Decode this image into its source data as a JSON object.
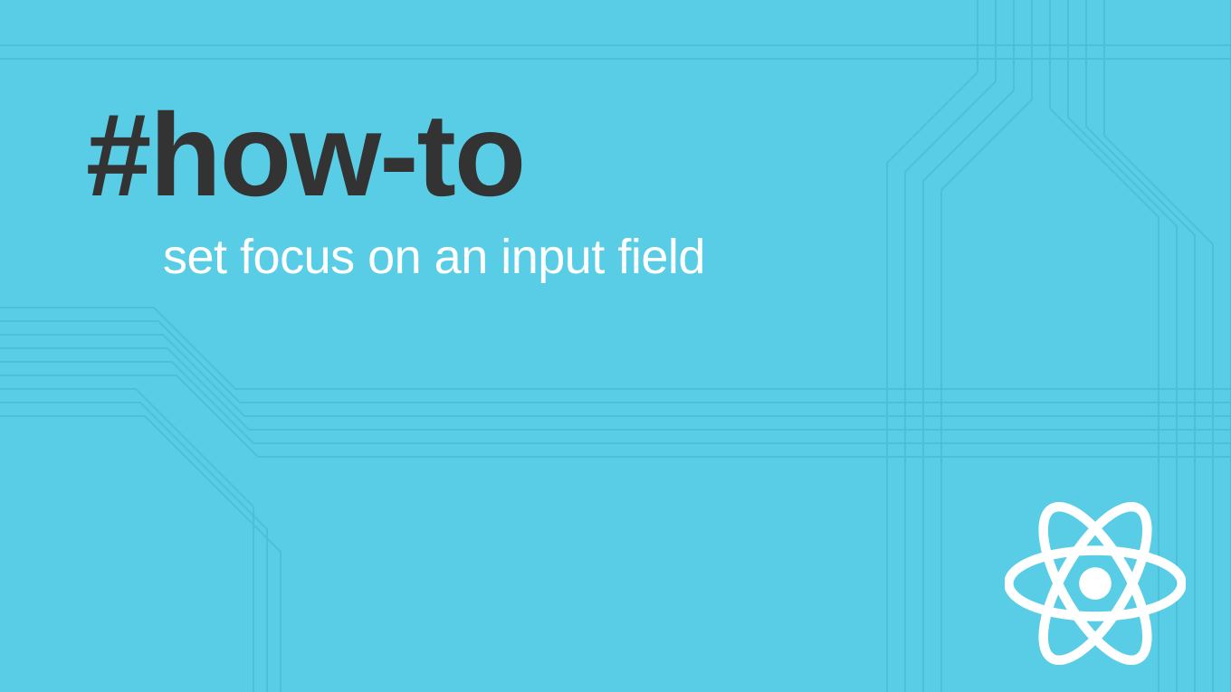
{
  "heading": "#how-to",
  "subheading": "set focus on an input field",
  "colors": {
    "background": "#59cde6",
    "headingColor": "#333333",
    "subheadingColor": "#ffffff",
    "circuitLineColor": "#4cc0d9"
  },
  "logo": "react-icon"
}
